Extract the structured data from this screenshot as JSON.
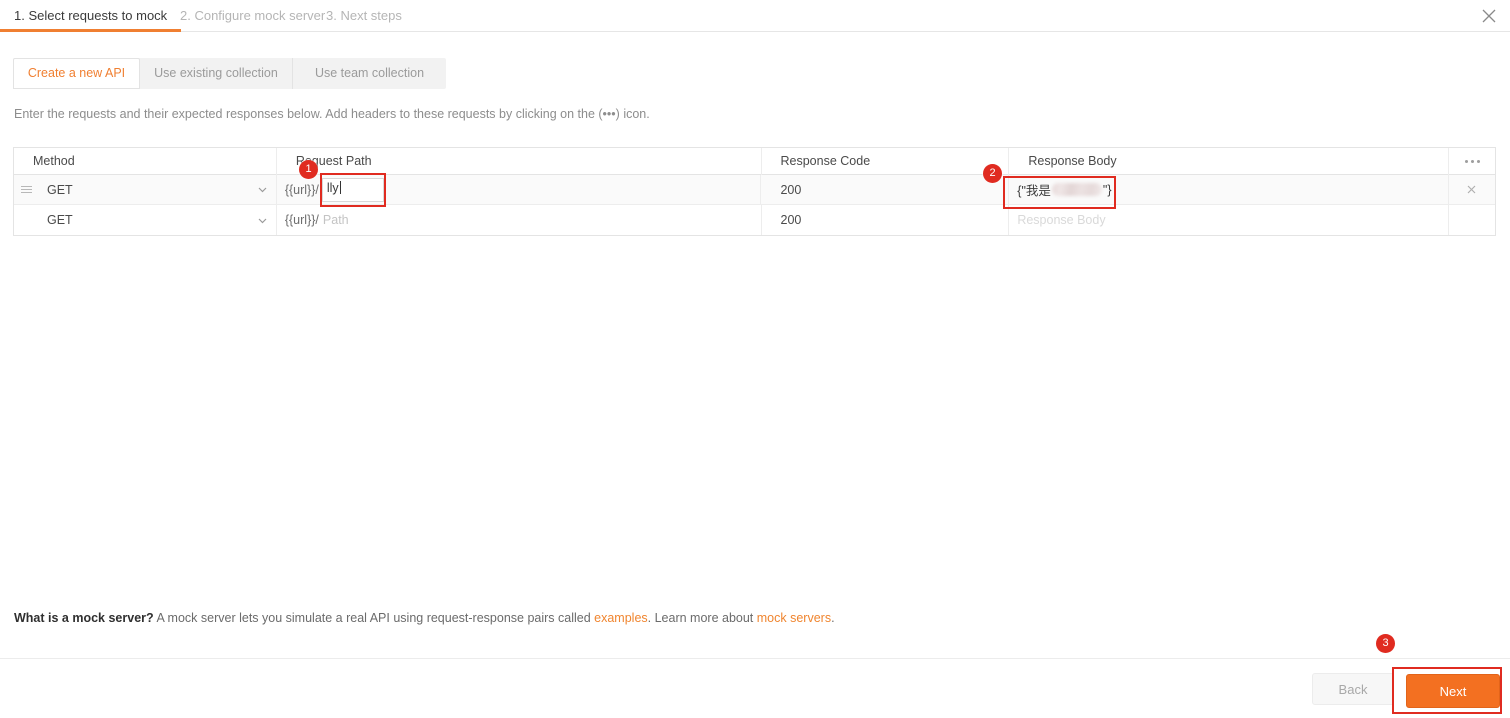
{
  "wizard": {
    "steps": [
      {
        "label": "1. Select requests to mock",
        "active": true
      },
      {
        "label": "2. Configure mock server",
        "active": false
      },
      {
        "label": "3. Next steps",
        "active": false
      }
    ],
    "close_icon": "close-icon",
    "accent_color": "#f07f31"
  },
  "subtabs": [
    {
      "label": "Create a new API",
      "active": true
    },
    {
      "label": "Use existing collection",
      "active": false
    },
    {
      "label": "Use team collection",
      "active": false
    }
  ],
  "helper_text": "Enter the requests and their expected responses below. Add headers to these requests by clicking on the (•••) icon.",
  "table": {
    "columns": [
      "Method",
      "Request Path",
      "Response Code",
      "Response Body"
    ],
    "overflow_icon": "ellipsis-icon",
    "rows": [
      {
        "drag_icon": "drag-handle-icon",
        "method": "GET",
        "chevron_icon": "chevron-down-icon",
        "url_prefix": "{{url}}/",
        "path_value": "lly",
        "path_placeholder": "Path",
        "response_code": "200",
        "response_body_prefix": "{\"我是",
        "response_body_suffix": "\"}",
        "response_body_redacted": true,
        "remove_icon": "close-icon",
        "selected": true
      },
      {
        "drag_icon": "",
        "method": "GET",
        "chevron_icon": "chevron-down-icon",
        "url_prefix": "{{url}}/",
        "path_value": "",
        "path_placeholder": "Path",
        "response_code": "200",
        "response_body_prefix": "",
        "response_body_suffix": "",
        "response_body_placeholder": "Response Body",
        "response_body_redacted": false,
        "remove_icon": "",
        "selected": false
      }
    ]
  },
  "footer_info": {
    "lead": "What is a mock server?",
    "text_1": " A mock server lets you simulate a real API using request-response pairs called ",
    "link_1": "examples",
    "text_2": ". Learn more about ",
    "link_2": "mock servers",
    "text_3": "."
  },
  "buttons": {
    "back": "Back",
    "next": "Next"
  },
  "annotations": {
    "badge_1": "1",
    "badge_2": "2",
    "badge_3": "3",
    "highlight_color": "#e02b20"
  }
}
